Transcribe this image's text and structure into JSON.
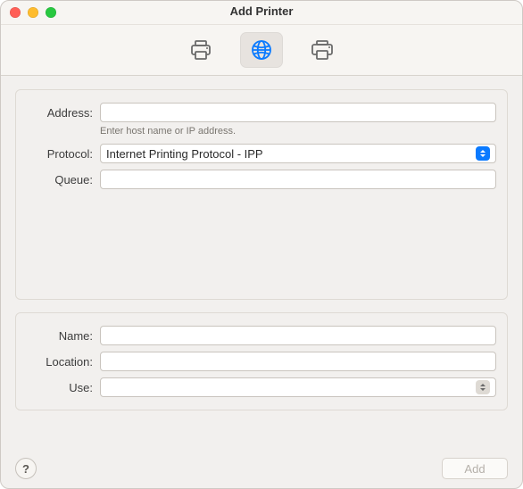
{
  "window": {
    "title": "Add Printer"
  },
  "toolbar": {
    "tabs": [
      {
        "name": "default-tab"
      },
      {
        "name": "ip-tab",
        "selected": true
      },
      {
        "name": "windows-tab"
      }
    ]
  },
  "fields": {
    "address": {
      "label": "Address:",
      "value": "",
      "hint": "Enter host name or IP address."
    },
    "protocol": {
      "label": "Protocol:",
      "value": "Internet Printing Protocol - IPP"
    },
    "queue": {
      "label": "Queue:",
      "value": ""
    },
    "name": {
      "label": "Name:",
      "value": ""
    },
    "location": {
      "label": "Location:",
      "value": ""
    },
    "use": {
      "label": "Use:",
      "value": ""
    }
  },
  "footer": {
    "help": "?",
    "add": "Add"
  }
}
